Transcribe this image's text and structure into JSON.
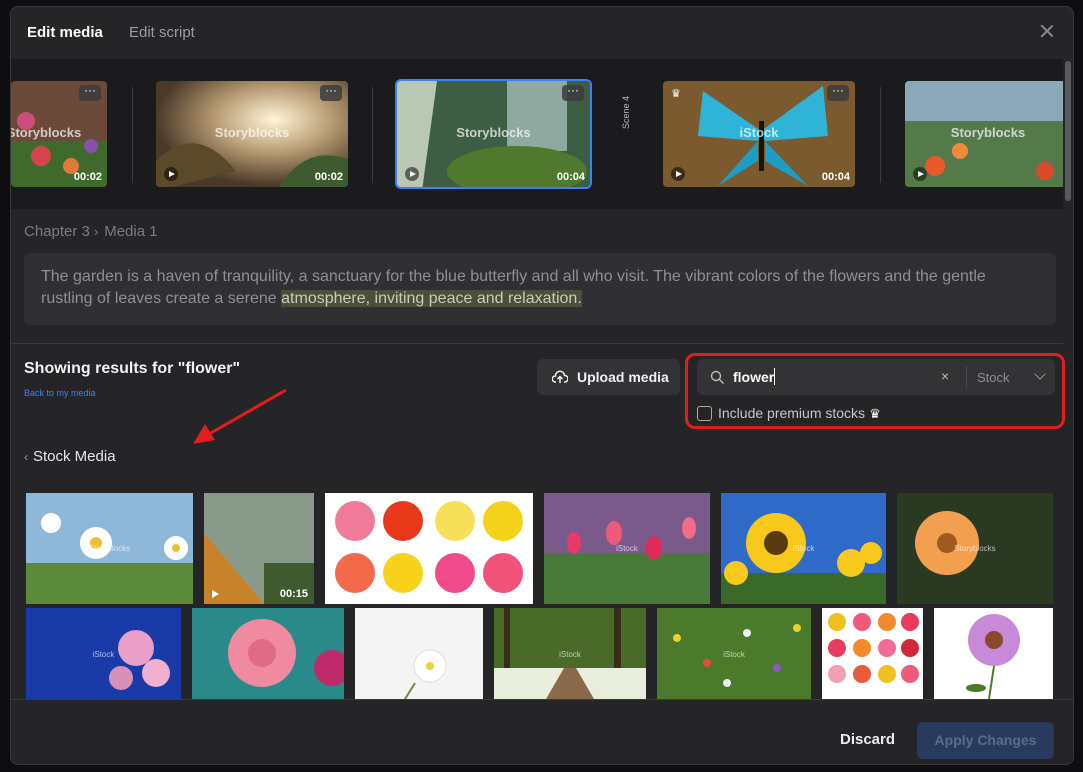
{
  "header": {
    "tab_active": "Edit media",
    "tab_inactive": "Edit script"
  },
  "filmstrip": {
    "scene_label": "Scene 4",
    "clips": [
      {
        "label": "Storyblocks",
        "duration": "00:02",
        "premium": false,
        "selected": false
      },
      {
        "label": "Storyblocks",
        "duration": "00:02",
        "premium": false,
        "selected": false
      },
      {
        "label": "Storyblocks",
        "duration": "00:04",
        "premium": false,
        "selected": true
      },
      {
        "label": "iStock",
        "duration": "00:04",
        "premium": true,
        "selected": false
      },
      {
        "label": "Storyblocks",
        "duration": "",
        "premium": false,
        "selected": false
      }
    ]
  },
  "breadcrumb": {
    "chapter": "Chapter 3",
    "media": "Media 1"
  },
  "script": {
    "text_before": "The garden is a haven of tranquility, a sanctuary for the blue butterfly and all who visit. The vibrant colors of the flowers and the gentle rustling of leaves create a serene ",
    "text_highlight": "atmosphere, inviting peace and relaxation."
  },
  "results": {
    "title": "Showing results for \"flower\"",
    "back_link": "Back to my media"
  },
  "upload": {
    "label": "Upload media"
  },
  "search": {
    "value": "flower",
    "source": "Stock",
    "premium_label": "Include premium stocks"
  },
  "stock": {
    "header": "Stock Media"
  },
  "grid": {
    "video_duration": "00:15",
    "watermarks": [
      "Storyblocks",
      "iStock",
      "iStock",
      "Storyblocks",
      "iStock",
      "iStock",
      "iStock"
    ]
  },
  "footer": {
    "discard": "Discard",
    "apply": "Apply Changes"
  },
  "colors": {
    "accent": "#3b82f6",
    "annotation_red": "#e21d1d",
    "panel_bg": "#252528"
  },
  "icons": [
    "close-icon",
    "more-icon",
    "play-icon",
    "crown-icon",
    "upload-cloud-icon",
    "search-icon",
    "clear-icon",
    "chevron-down-icon",
    "back-chevron-icon"
  ]
}
